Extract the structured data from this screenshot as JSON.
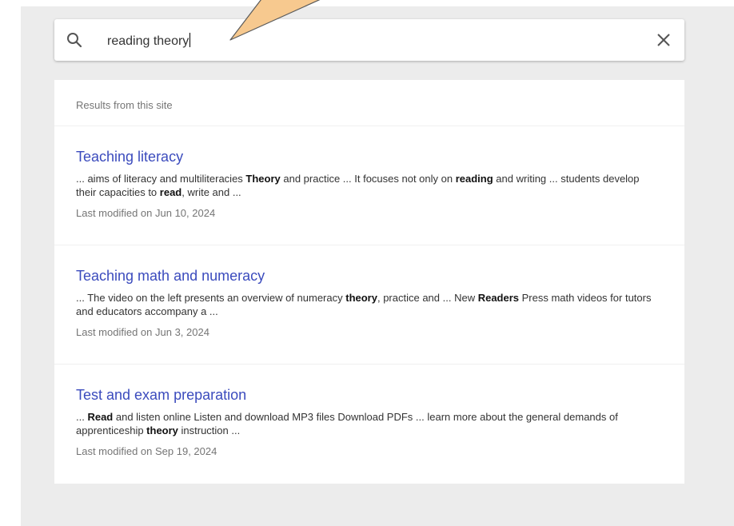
{
  "search": {
    "query": "reading theory",
    "search_icon": "search-icon",
    "close_icon": "close-icon"
  },
  "results": {
    "header": "Results from this site",
    "items": [
      {
        "title": "Teaching literacy",
        "snippet": [
          {
            "t": "... aims of literacy and multiliteracies ",
            "b": false
          },
          {
            "t": "Theory",
            "b": true
          },
          {
            "t": " and practice ... It focuses not only on ",
            "b": false
          },
          {
            "t": "reading",
            "b": true
          },
          {
            "t": " and writing ... students develop their capacities to ",
            "b": false
          },
          {
            "t": "read",
            "b": true
          },
          {
            "t": ", write and ...",
            "b": false
          }
        ],
        "modified": "Last modified on Jun 10, 2024"
      },
      {
        "title": "Teaching math and numeracy",
        "snippet": [
          {
            "t": "... The video on the left presents an overview of numeracy ",
            "b": false
          },
          {
            "t": "theory",
            "b": true
          },
          {
            "t": ", practice and ... New ",
            "b": false
          },
          {
            "t": "Readers",
            "b": true
          },
          {
            "t": " Press math videos for tutors and educators accompany a ...",
            "b": false
          }
        ],
        "modified": "Last modified on Jun 3, 2024"
      },
      {
        "title": "Test and exam preparation",
        "snippet": [
          {
            "t": "... ",
            "b": false
          },
          {
            "t": "Read",
            "b": true
          },
          {
            "t": " and listen online Listen and download MP3 files Download PDFs ... learn more about the general demands of apprenticeship ",
            "b": false
          },
          {
            "t": "theory",
            "b": true
          },
          {
            "t": " instruction ...",
            "b": false
          }
        ],
        "modified": "Last modified on Sep 19, 2024"
      }
    ]
  },
  "colors": {
    "link": "#3b4bbd",
    "pointer_fill": "#f7c98f",
    "pointer_stroke": "#5a5a5a",
    "panel_bg": "#ececec"
  }
}
